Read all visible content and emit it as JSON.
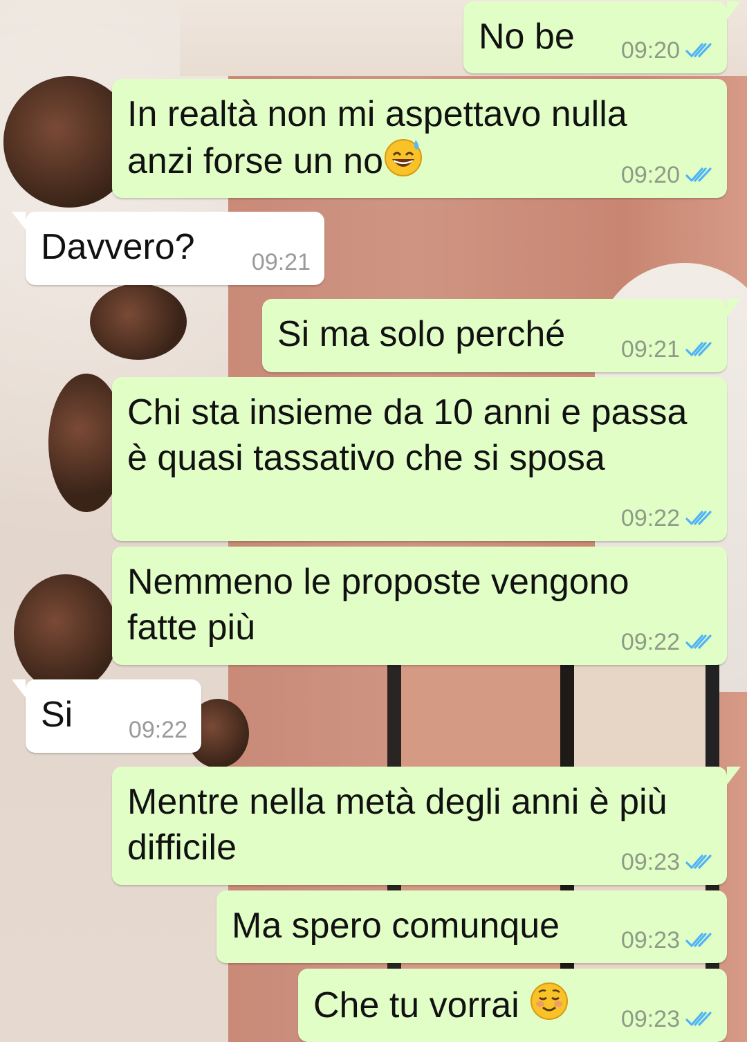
{
  "messages": [
    {
      "text": "No be",
      "time": "09:20",
      "dir": "out",
      "status_icon": "double-check-read-icon"
    },
    {
      "text": "In realtà non mi aspettavo nulla\nanzi forse un no",
      "emoji": "grinning-sweat-emoji",
      "time": "09:20",
      "dir": "out",
      "status_icon": "double-check-read-icon"
    },
    {
      "text": "Davvero?",
      "time": "09:21",
      "dir": "in"
    },
    {
      "text": "Si ma solo perché",
      "time": "09:21",
      "dir": "out",
      "status_icon": "double-check-read-icon"
    },
    {
      "text": "Chi sta insieme da 10 anni e passa\nè quasi tassativo che si sposa",
      "time": "09:22",
      "dir": "out",
      "status_icon": "double-check-read-icon"
    },
    {
      "text": "Nemmeno le proposte vengono\nfatte più",
      "time": "09:22",
      "dir": "out",
      "status_icon": "double-check-read-icon"
    },
    {
      "text": "Si",
      "time": "09:22",
      "dir": "in"
    },
    {
      "text": "Mentre nella metà degli anni è più\ndifficile",
      "time": "09:23",
      "dir": "out",
      "status_icon": "double-check-read-icon"
    },
    {
      "text": "Ma spero comunque",
      "time": "09:23",
      "dir": "out",
      "status_icon": "double-check-read-icon"
    },
    {
      "text": "Che tu vorrai",
      "emoji": "smiling-blush-emoji",
      "time": "09:23",
      "dir": "out",
      "status_icon": "double-check-read-icon"
    }
  ],
  "colors": {
    "outgoing_bubble": "#e1fec6",
    "incoming_bubble": "#ffffff",
    "read_ticks": "#4fb3f6",
    "timestamp_out": "#8e9a86",
    "timestamp_in": "#9a9a9a"
  }
}
